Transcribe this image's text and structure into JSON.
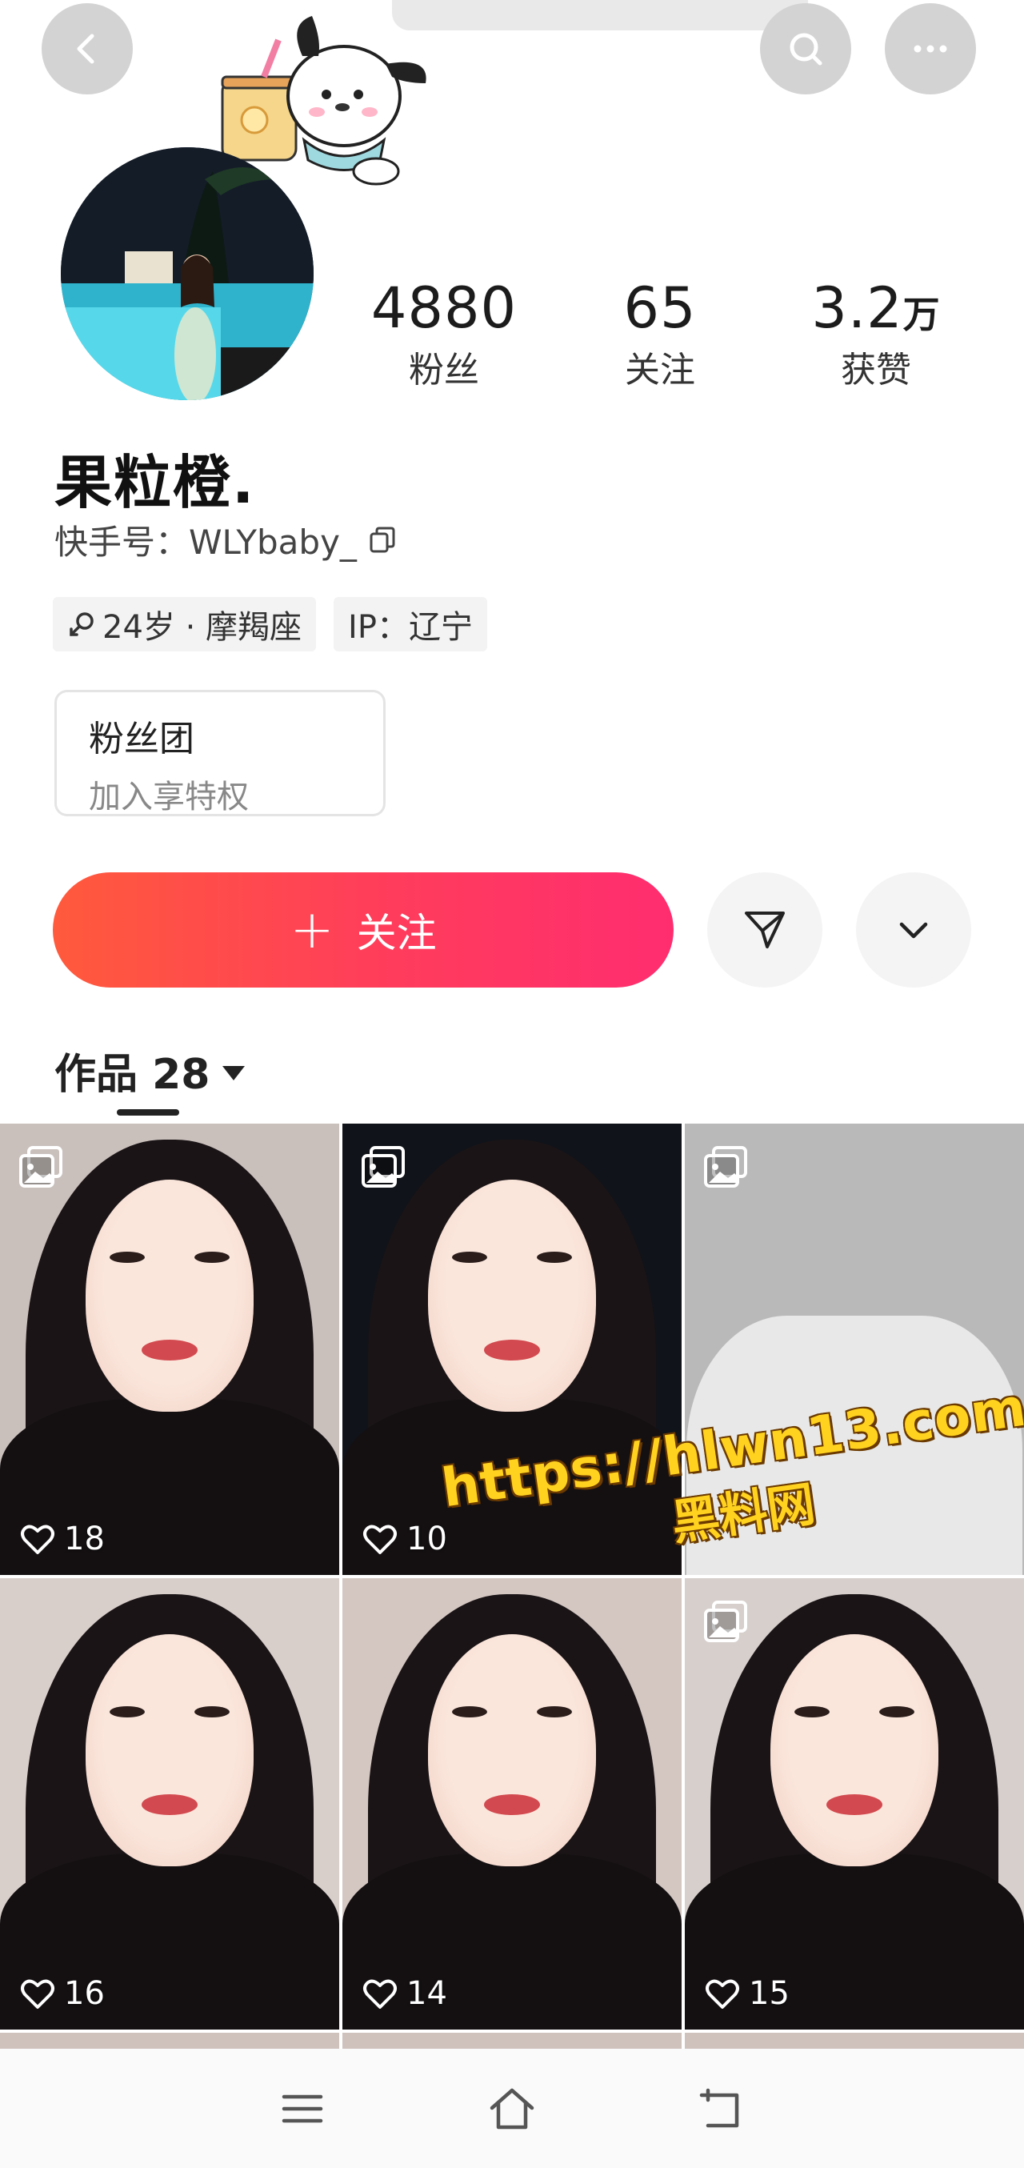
{
  "stats": [
    {
      "value": "4880",
      "unit": "",
      "label": "粉丝"
    },
    {
      "value": "65",
      "unit": "",
      "label": "关注"
    },
    {
      "value": "3.2",
      "unit": "万",
      "label": "获赞"
    }
  ],
  "profile": {
    "nickname": "果粒橙.",
    "user_id": "快手号：WLYbaby_",
    "tags": [
      "24岁 · 摩羯座",
      "IP：辽宁"
    ]
  },
  "fan_club": {
    "title": "粉丝团",
    "subtitle": "加入享特权"
  },
  "actions": {
    "follow_label": "关注"
  },
  "works": {
    "label": "作品 28"
  },
  "posts": [
    {
      "likes": "18",
      "multi_image": true,
      "bg": "#c9c0bc"
    },
    {
      "likes": "10",
      "multi_image": true,
      "bg": "#101319"
    },
    {
      "likes": "",
      "multi_image": true,
      "bg": "#b9b9b9"
    },
    {
      "likes": "16",
      "multi_image": false,
      "bg": "#d8cfcb"
    },
    {
      "likes": "14",
      "multi_image": false,
      "bg": "#d4c7c2"
    },
    {
      "likes": "15",
      "multi_image": true,
      "bg": "#d6cfcc"
    }
  ],
  "watermark": {
    "url": "https://hlwn13.com",
    "site": "黑料网"
  },
  "colors": {
    "follow_start": "#ff5a3c",
    "follow_end": "#ff2d6f",
    "watermark": "#ffd21f"
  },
  "icons": {
    "top_left": "back-icon",
    "top_right": [
      "search-icon",
      "more-icon"
    ],
    "action_buttons": [
      "send-message-icon",
      "chevron-down-icon"
    ],
    "nav": [
      "menu-icon",
      "home-icon",
      "back-nav-icon"
    ]
  }
}
